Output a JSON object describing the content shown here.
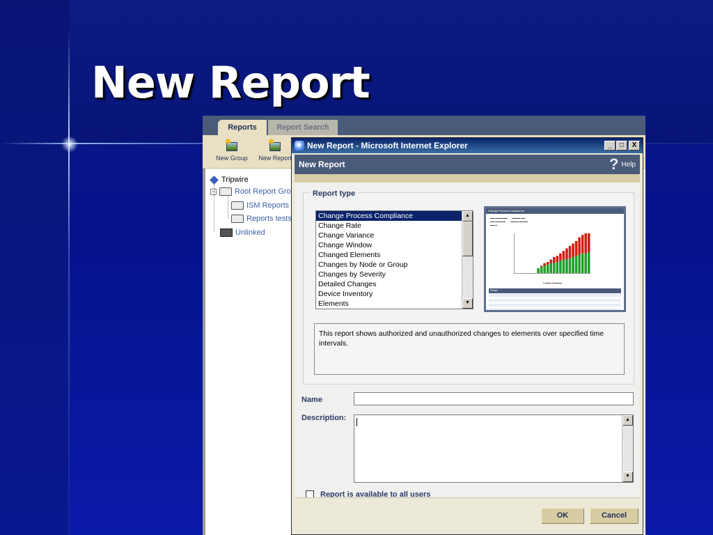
{
  "slide": {
    "title": "New Report"
  },
  "app": {
    "tabs": [
      {
        "label": "Reports"
      },
      {
        "label": "Report Search"
      }
    ],
    "toolbar": [
      {
        "label": "New Group"
      },
      {
        "label": "New Report"
      }
    ],
    "tree": [
      {
        "label": "Tripwire"
      },
      {
        "label": "Root Report Group"
      },
      {
        "label": "ISM Reports"
      },
      {
        "label": "Reports tests"
      },
      {
        "label": "Unlinked"
      }
    ]
  },
  "dialog": {
    "window_title": "New Report - Microsoft Internet Explorer",
    "window_buttons": {
      "minimize": "_",
      "maximize": "□",
      "close": "X"
    },
    "header_title": "New Report",
    "help_label": "Help",
    "report_type_legend": "Report type",
    "report_types": [
      "Change Process Compliance",
      "Change Rate",
      "Change Variance",
      "Change Window",
      "Changed Elements",
      "Changes by Node or Group",
      "Changes by Severity",
      "Detailed Changes",
      "Device Inventory",
      "Elements"
    ],
    "selected_report_type": "Change Process Compliance",
    "preview": {
      "title": "Change Process Compliance",
      "details_label": "Details",
      "accent_authorized": "#1fa02a",
      "accent_unauthorized": "#d21c10"
    },
    "report_description": "This report shows authorized and unauthorized changes to elements over specified time intervals.",
    "name_label": "Name",
    "name_value": "",
    "description_label": "Description:",
    "description_value": "",
    "checkbox_label": "Report is available to all users",
    "ok_label": "OK",
    "cancel_label": "Cancel"
  }
}
